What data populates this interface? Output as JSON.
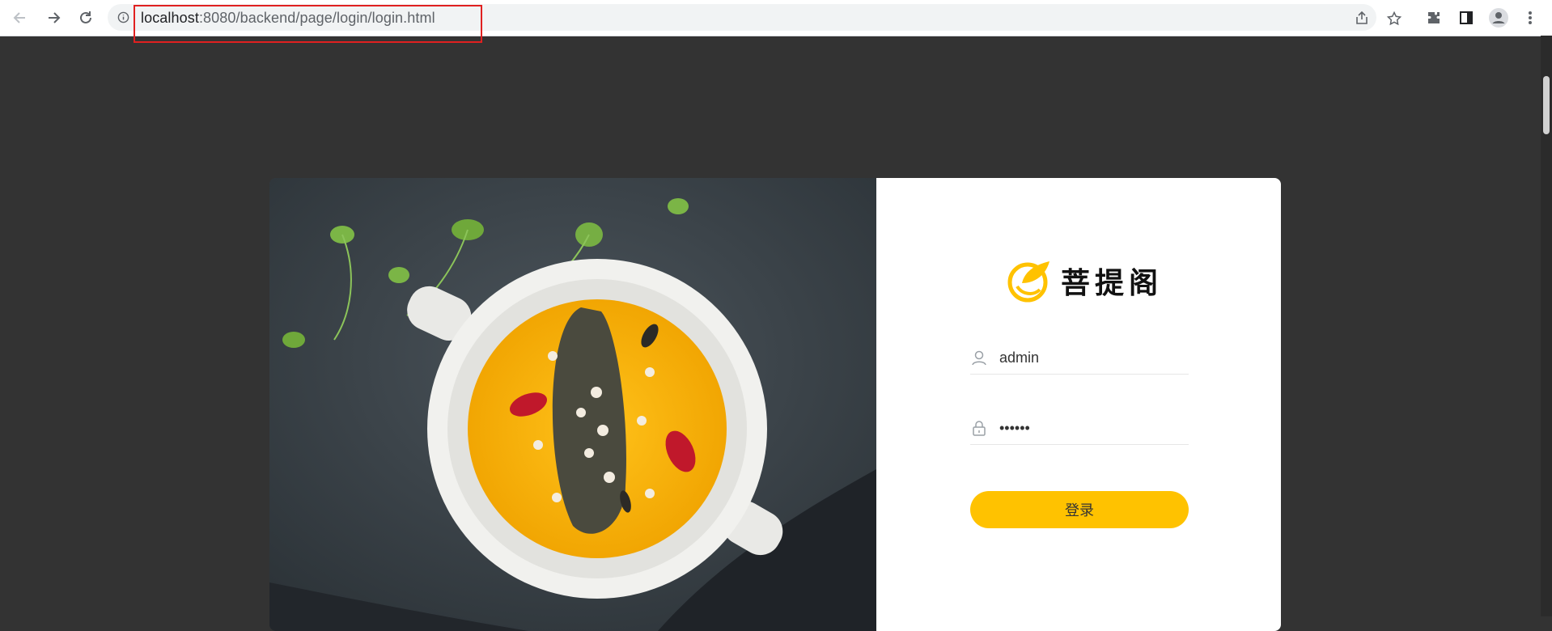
{
  "browser": {
    "url_host": "localhost",
    "url_rest": ":8080/backend/page/login/login.html",
    "icons": [
      "back-icon",
      "forward-icon",
      "reload-icon",
      "info-icon",
      "share-icon",
      "bookmark-star-icon",
      "extensions-icon",
      "side-panel-icon",
      "profile-icon",
      "menu-icon"
    ]
  },
  "login": {
    "brand_name": "菩提阁",
    "username_value": "admin",
    "password_value": "123456",
    "submit_label": "登录"
  },
  "colors": {
    "accent": "#ffc200",
    "page_bg": "#333333",
    "highlight": "#e02020"
  }
}
